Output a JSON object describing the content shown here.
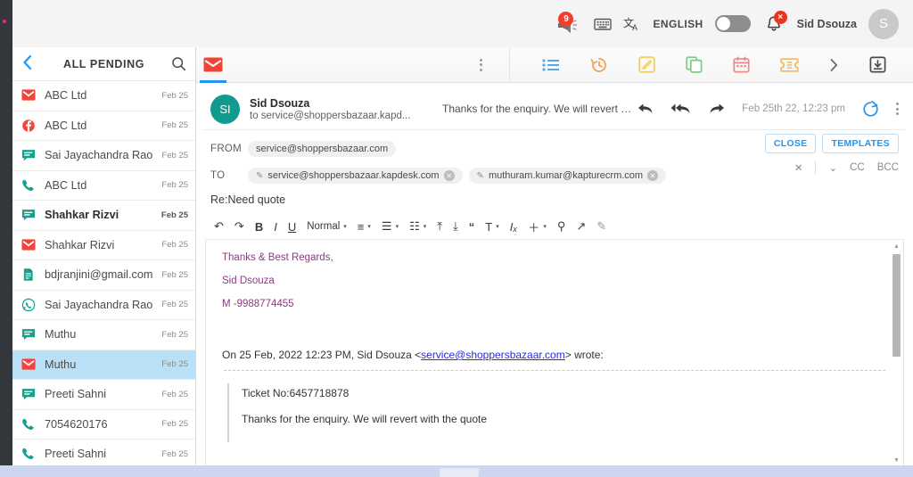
{
  "header": {
    "announcement_badge": "9",
    "announcement_icon": "megaphone-icon",
    "keyboard_icon": "keyboard-icon",
    "translate_icon": "translate-icon",
    "language": "ENGLISH",
    "toggle_state": "off",
    "bell_icon": "bell-icon",
    "bell_badge": "×",
    "user_name": "Sid Dsouza",
    "avatar_initial": "S"
  },
  "sidebar": {
    "back_icon": "chevron-left-icon",
    "title": "ALL PENDING",
    "search_icon": "search-icon",
    "items": [
      {
        "icon": "email-icon",
        "label": "ABC Ltd",
        "date": "Feb 25",
        "unread": false,
        "selected": false
      },
      {
        "icon": "facebook-icon",
        "label": "ABC Ltd",
        "date": "Feb 25",
        "unread": false,
        "selected": false
      },
      {
        "icon": "chat-icon",
        "label": "Sai Jayachandra Rao",
        "date": "Feb 25",
        "unread": false,
        "selected": false
      },
      {
        "icon": "phone-icon",
        "label": "ABC Ltd",
        "date": "Feb 25",
        "unread": false,
        "selected": false
      },
      {
        "icon": "chat-icon",
        "label": "Shahkar Rizvi",
        "date": "Feb 25",
        "unread": true,
        "selected": false
      },
      {
        "icon": "email-icon",
        "label": "Shahkar Rizvi",
        "date": "Feb 25",
        "unread": false,
        "selected": false
      },
      {
        "icon": "document-icon",
        "label": "bdjranjini@gmail.com",
        "date": "Feb 25",
        "unread": false,
        "selected": false
      },
      {
        "icon": "whatsapp-icon",
        "label": "Sai Jayachandra Rao",
        "date": "Feb 25",
        "unread": false,
        "selected": false
      },
      {
        "icon": "chat-icon",
        "label": "Muthu",
        "date": "Feb 25",
        "unread": false,
        "selected": false
      },
      {
        "icon": "email-icon",
        "label": "Muthu",
        "date": "Feb 25",
        "unread": false,
        "selected": true
      },
      {
        "icon": "chat-icon",
        "label": "Preeti Sahni",
        "date": "Feb 25",
        "unread": false,
        "selected": false
      },
      {
        "icon": "phone-icon",
        "label": "7054620176",
        "date": "Feb 25",
        "unread": false,
        "selected": false
      },
      {
        "icon": "phone-icon",
        "label": "Preeti Sahni",
        "date": "Feb 25",
        "unread": false,
        "selected": false
      }
    ]
  },
  "tabs": {
    "active_icon": "email-tab-icon",
    "kebab_icon": "more-vertical-icon",
    "tools": [
      {
        "icon": "list-icon",
        "color": "#5aa9e6"
      },
      {
        "icon": "history-icon",
        "color": "#f2a254"
      },
      {
        "icon": "note-edit-icon",
        "color": "#f5cf5b"
      },
      {
        "icon": "copy-icon",
        "color": "#7fc986"
      },
      {
        "icon": "calendar-icon",
        "color": "#f08a8a"
      },
      {
        "icon": "ticket-icon",
        "color": "#f3b661"
      },
      {
        "icon": "chevron-right-icon",
        "color": "#6b6b6b"
      },
      {
        "icon": "archive-icon",
        "color": "#4a4a4a"
      }
    ]
  },
  "message": {
    "avatar_initials": "SI",
    "from_name": "Sid Dsouza",
    "to_line": "to service@shoppersbazaar.kapd...",
    "snippet": "Thanks for the enquiry. We will revert wit...",
    "reply_icon": "reply-icon",
    "reply_all_icon": "reply-all-icon",
    "forward_icon": "forward-icon",
    "date": "Feb 25th 22, 12:23 pm",
    "refresh_icon": "refresh-icon",
    "more_icon": "more-vertical-icon"
  },
  "compose": {
    "from_label": "FROM",
    "from_value": "service@shoppersbazaar.com",
    "to_label": "TO",
    "to_chips": [
      "service@shoppersbazaar.kapdesk.com",
      "muthuram.kumar@kapturecrm.com"
    ],
    "chip_edit_icon": "pencil-icon",
    "chip_remove_icon": "remove-chip-icon",
    "subject": "Re:Need quote",
    "close_label": "CLOSE",
    "templates_label": "TEMPLATES",
    "clear_icon": "close-icon",
    "expand_icon": "chevron-down-icon",
    "cc_label": "CC",
    "bcc_label": "BCC"
  },
  "editor": {
    "toolbar": [
      {
        "icon": "undo-icon",
        "glyph": "↶"
      },
      {
        "icon": "redo-icon",
        "glyph": "↷"
      },
      {
        "icon": "bold-icon",
        "glyph": "B"
      },
      {
        "icon": "italic-icon",
        "glyph": "I"
      },
      {
        "icon": "underline-icon",
        "glyph": "U"
      },
      {
        "icon": "font-size-select",
        "glyph": "Normal"
      },
      {
        "icon": "align-icon",
        "glyph": "≡"
      },
      {
        "icon": "bullet-list-icon",
        "glyph": "☰"
      },
      {
        "icon": "numbered-list-icon",
        "glyph": "☷"
      },
      {
        "icon": "outdent-icon",
        "glyph": "⤒"
      },
      {
        "icon": "indent-icon",
        "glyph": "⤓"
      },
      {
        "icon": "quote-icon",
        "glyph": "“"
      },
      {
        "icon": "text-color-icon",
        "glyph": "T"
      },
      {
        "icon": "clear-format-icon",
        "glyph": "Iₓ"
      },
      {
        "icon": "insert-icon",
        "glyph": "＋"
      },
      {
        "icon": "search-icon",
        "glyph": "⚲"
      },
      {
        "icon": "fullscreen-icon",
        "glyph": "↗"
      },
      {
        "icon": "signature-icon",
        "glyph": "✎"
      }
    ],
    "signature_lines": [
      "Thanks & Best Regards,",
      "Sid Dsouza",
      "M -9988774455"
    ],
    "quote_prefix": "On 25 Feb, 2022 12:23 PM, Sid Dsouza <",
    "quote_link": "service@shoppersbazaar.com",
    "quote_suffix": "> wrote:",
    "quoted_lines": [
      "Ticket No:6457718878",
      "Thanks for the enquiry. We will revert with the quote"
    ],
    "scroll_up_icon": "scroll-up-icon",
    "scroll_down_icon": "scroll-down-icon"
  }
}
